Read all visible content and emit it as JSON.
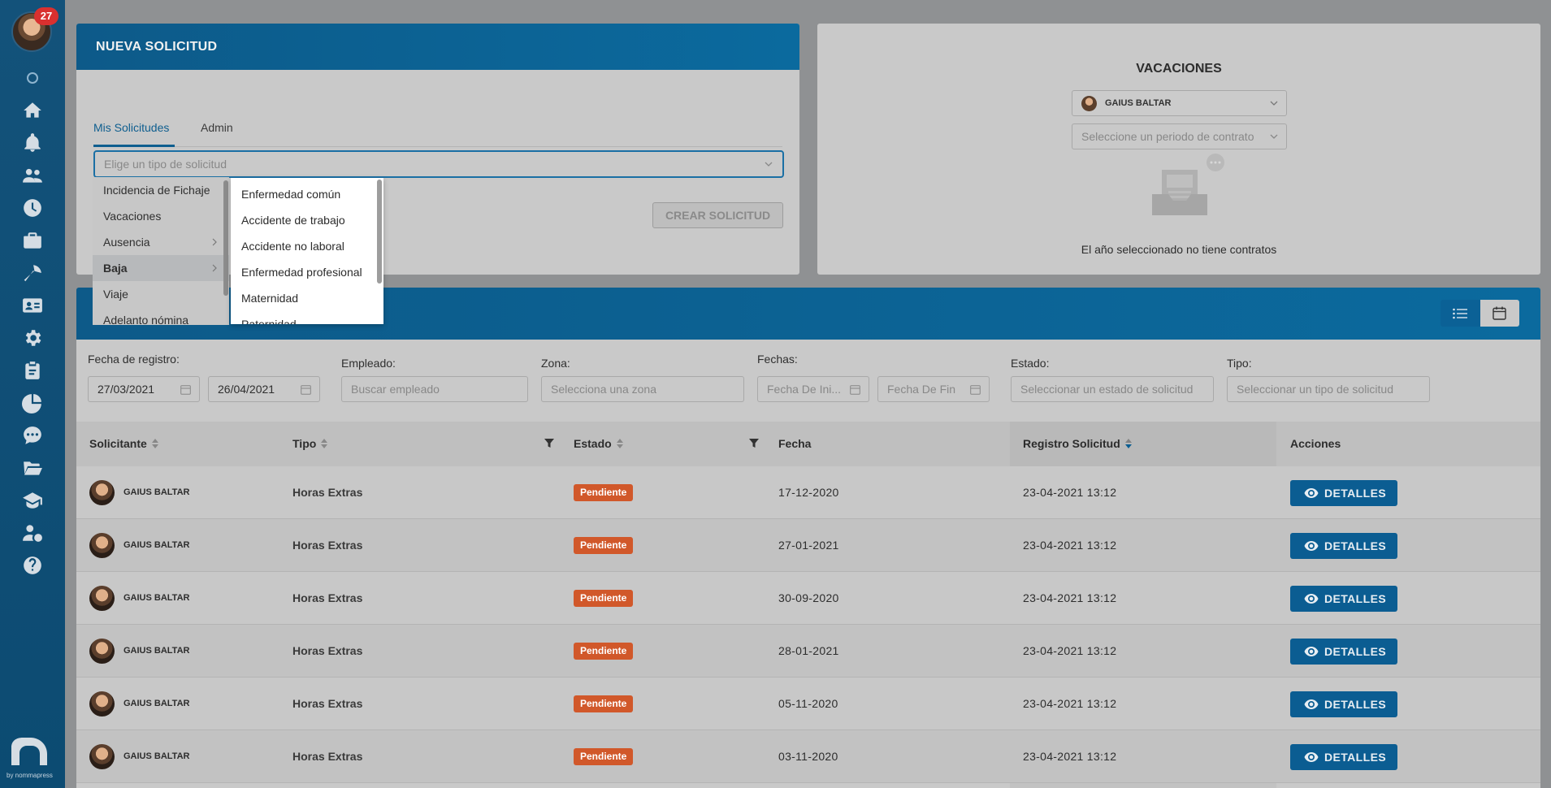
{
  "sidebar": {
    "notification_count": "27",
    "brand_text": "by nommapress"
  },
  "new_request": {
    "title": "NUEVA SOLICITUD",
    "tabs": [
      {
        "label": "Mis Solicitudes"
      },
      {
        "label": "Admin"
      }
    ],
    "type_placeholder": "Elige un tipo de solicitud",
    "create_button": "CREAR SOLICITUD",
    "menu_level1": [
      {
        "label": "Incidencia de Fichaje"
      },
      {
        "label": "Vacaciones"
      },
      {
        "label": "Ausencia"
      },
      {
        "label": "Baja"
      },
      {
        "label": "Viaje"
      },
      {
        "label": "Adelanto nómina"
      }
    ],
    "menu_level2": [
      {
        "label": "Enfermedad común"
      },
      {
        "label": "Accidente de trabajo"
      },
      {
        "label": "Accidente no laboral"
      },
      {
        "label": "Enfermedad profesional"
      },
      {
        "label": "Maternidad"
      },
      {
        "label": "Paternidad"
      }
    ]
  },
  "vacations": {
    "title": "VACACIONES",
    "employee": "GAIUS BALTAR",
    "period_placeholder": "Seleccione un periodo de contrato",
    "empty_message": "El año seleccionado no tiene contratos"
  },
  "filters": {
    "registration_label": "Fecha de registro:",
    "registration_from": "27/03/2021",
    "registration_to": "26/04/2021",
    "employee_label": "Empleado:",
    "employee_placeholder": "Buscar empleado",
    "zone_label": "Zona:",
    "zone_placeholder": "Selecciona una zona",
    "dates_label": "Fechas:",
    "date_start_placeholder": "Fecha De Ini...",
    "date_end_placeholder": "Fecha De Fin",
    "status_label": "Estado:",
    "status_placeholder": "Seleccionar un estado de solicitud",
    "type_label": "Tipo:",
    "type_placeholder": "Seleccionar un tipo de solicitud"
  },
  "table": {
    "columns": {
      "requester": "Solicitante",
      "type": "Tipo",
      "status": "Estado",
      "date": "Fecha",
      "registration": "Registro Solicitud",
      "actions": "Acciones"
    },
    "rows": [
      {
        "employee": "GAIUS BALTAR",
        "type": "Horas Extras",
        "status": "Pendiente",
        "date": "17-12-2020",
        "registration": "23-04-2021 13:12",
        "action": "DETALLES"
      },
      {
        "employee": "GAIUS BALTAR",
        "type": "Horas Extras",
        "status": "Pendiente",
        "date": "27-01-2021",
        "registration": "23-04-2021 13:12",
        "action": "DETALLES"
      },
      {
        "employee": "GAIUS BALTAR",
        "type": "Horas Extras",
        "status": "Pendiente",
        "date": "30-09-2020",
        "registration": "23-04-2021 13:12",
        "action": "DETALLES"
      },
      {
        "employee": "GAIUS BALTAR",
        "type": "Horas Extras",
        "status": "Pendiente",
        "date": "28-01-2021",
        "registration": "23-04-2021 13:12",
        "action": "DETALLES"
      },
      {
        "employee": "GAIUS BALTAR",
        "type": "Horas Extras",
        "status": "Pendiente",
        "date": "05-11-2020",
        "registration": "23-04-2021 13:12",
        "action": "DETALLES"
      },
      {
        "employee": "GAIUS BALTAR",
        "type": "Horas Extras",
        "status": "Pendiente",
        "date": "03-11-2020",
        "registration": "23-04-2021 13:12",
        "action": "DETALLES"
      }
    ]
  },
  "colors": {
    "primary": "#0b6196",
    "status_pending": "#d1582a",
    "sidebar": "#13527a"
  }
}
